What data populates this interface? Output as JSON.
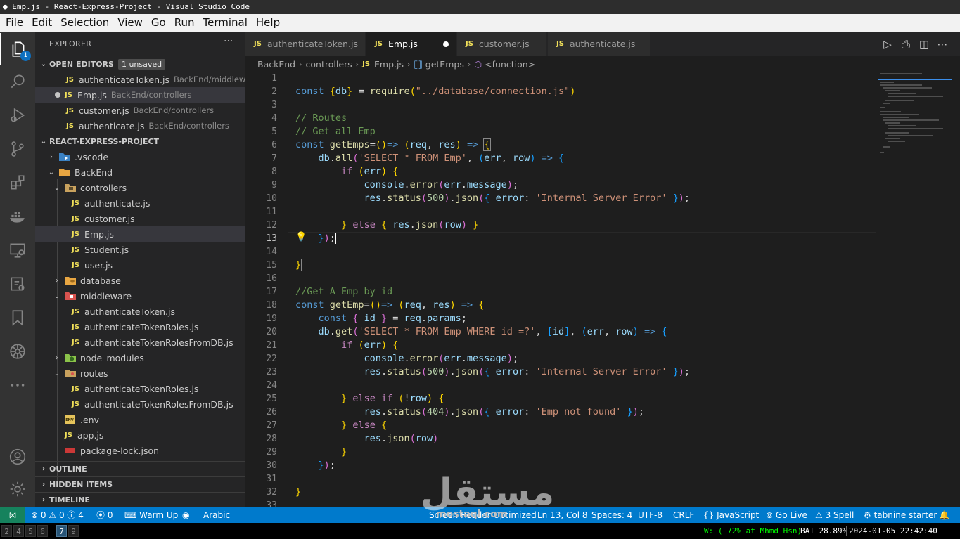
{
  "window": {
    "title": "● Emp.js - React-Express-Project - Visual Studio Code"
  },
  "menu": [
    "File",
    "Edit",
    "Selection",
    "View",
    "Go",
    "Run",
    "Terminal",
    "Help"
  ],
  "activity_bar": {
    "explorer_badge": "1"
  },
  "sidebar": {
    "title": "EXPLORER",
    "more": "···",
    "open_editors": {
      "label": "OPEN EDITORS",
      "badge": "1 unsaved",
      "items": [
        {
          "name": "authenticateToken.js",
          "path": "BackEnd/middlew..."
        },
        {
          "name": "Emp.js",
          "path": "BackEnd/controllers"
        },
        {
          "name": "customer.js",
          "path": "BackEnd/controllers"
        },
        {
          "name": "authenticate.js",
          "path": "BackEnd/controllers"
        }
      ]
    },
    "project": {
      "label": "REACT-EXPRESS-PROJECT",
      "tree": [
        {
          "label": ".vscode"
        },
        {
          "label": "BackEnd"
        },
        {
          "label": "controllers"
        },
        {
          "label": "authenticate.js"
        },
        {
          "label": "customer.js"
        },
        {
          "label": "Emp.js"
        },
        {
          "label": "Student.js"
        },
        {
          "label": "user.js"
        },
        {
          "label": "database"
        },
        {
          "label": "middleware"
        },
        {
          "label": "authenticateToken.js"
        },
        {
          "label": "authenticateTokenRoles.js"
        },
        {
          "label": "authenticateTokenRolesFromDB.js"
        },
        {
          "label": "node_modules"
        },
        {
          "label": "routes"
        },
        {
          "label": "authenticateTokenRoles.js"
        },
        {
          "label": "authenticateTokenRolesFromDB.js"
        },
        {
          "label": ".env"
        },
        {
          "label": "app.js"
        },
        {
          "label": "package-lock.json"
        }
      ]
    },
    "outline": "OUTLINE",
    "hidden_items": "HIDDEN ITEMS",
    "timeline": "TIMELINE",
    "icon_labels": {
      "js": "JS",
      "env": "ENV"
    }
  },
  "tabs": [
    {
      "label": "authenticateToken.js"
    },
    {
      "label": "Emp.js"
    },
    {
      "label": "customer.js"
    },
    {
      "label": "authenticate.js"
    }
  ],
  "breadcrumb": {
    "parts": [
      "BackEnd",
      "controllers",
      "Emp.js",
      "getEmps",
      "<function>"
    ],
    "js": "JS"
  },
  "editor": {
    "current_line": 13,
    "lines": [
      "1",
      "2",
      "3",
      "4",
      "5",
      "6",
      "7",
      "8",
      "9",
      "10",
      "11",
      "12",
      "13",
      "14",
      "15",
      "16",
      "17",
      "18",
      "19",
      "20",
      "21",
      "22",
      "23",
      "24",
      "25",
      "26",
      "27",
      "28",
      "29",
      "30",
      "31",
      "32",
      "33"
    ]
  },
  "status": {
    "errors": "0",
    "warnings": "0",
    "info": "4",
    "ports": "0",
    "warm_up": "Warm Up",
    "language_keyboard": "Arabic",
    "screen_reader": "Screen Reader Optimized",
    "cursor": "Ln 13, Col 8",
    "spaces": "Spaces: 4",
    "encoding": "UTF-8",
    "eol": "CRLF",
    "language": "JavaScript",
    "go_live": "Go Live",
    "spell": "3 Spell",
    "tabnine": "tabnine starter"
  },
  "i3": {
    "workspaces": [
      "2",
      "4",
      "5",
      "6",
      "7",
      "9"
    ],
    "focused": "7",
    "wifi": "W: ( 72% at Mhmd Hsn)",
    "battery": "BAT 28.89%",
    "datetime": "2024-01-05 22:42:40"
  },
  "watermark": {
    "text": "مستقل",
    "url": "mostaql.com"
  }
}
